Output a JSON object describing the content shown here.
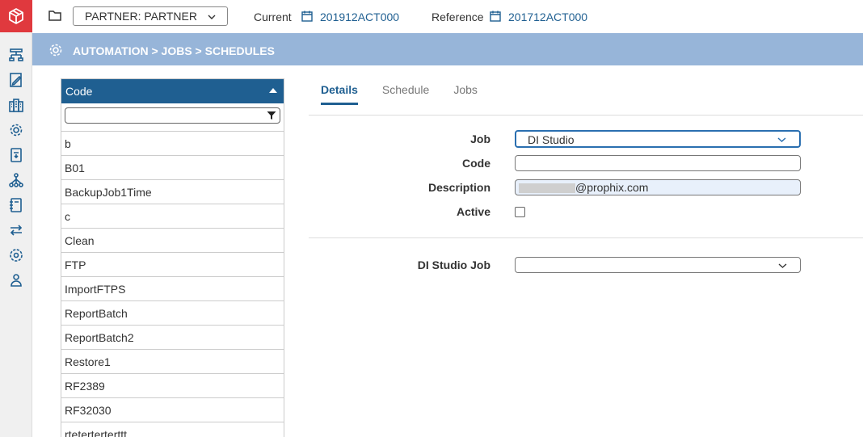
{
  "topbar": {
    "partner": "PARTNER: PARTNER",
    "current_label": "Current",
    "current_value": "201912ACT000",
    "reference_label": "Reference",
    "reference_value": "201712ACT000"
  },
  "breadcrumb": "AUTOMATION > JOBS > SCHEDULES",
  "codelist": {
    "header": "Code",
    "filter_value": "",
    "items": [
      "b",
      "B01",
      "BackupJob1Time",
      "c",
      "Clean",
      "FTP",
      "ImportFTPS",
      "ReportBatch",
      "ReportBatch2",
      "Restore1",
      "RF2389",
      "RF32030",
      "rteterterterttt"
    ]
  },
  "tabs": [
    "Details",
    "Schedule",
    "Jobs"
  ],
  "form": {
    "job_label": "Job",
    "job_value": "DI Studio",
    "code_label": "Code",
    "code_value": "",
    "description_label": "Description",
    "description_value": "@prophix.com",
    "active_label": "Active",
    "di_studio_job_label": "DI Studio Job",
    "di_studio_job_value": ""
  },
  "colors": {
    "brand": "#e0393e",
    "accent": "#1f5f91",
    "crumb_bg": "#97b5d9"
  },
  "icons": [
    "logo-icon",
    "hierarchy-icon",
    "report-edit-icon",
    "buildings-icon",
    "automation-gear-icon",
    "document-icon",
    "network-icon",
    "notebook-icon",
    "transfer-icon",
    "settings-icon",
    "users-icon"
  ]
}
